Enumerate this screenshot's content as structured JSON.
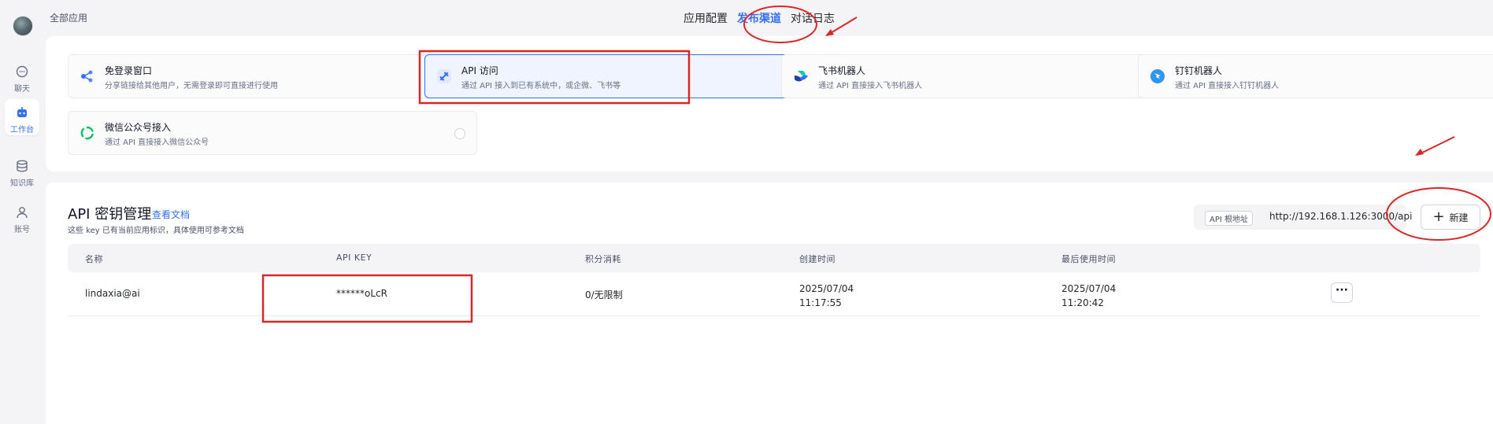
{
  "breadcrumb": "全部应用",
  "sidebar": {
    "items": [
      {
        "label": "聊天"
      },
      {
        "label": "工作台"
      },
      {
        "label": "知识库"
      },
      {
        "label": "账号"
      }
    ]
  },
  "tabs": [
    {
      "label": "应用配置"
    },
    {
      "label": "发布渠道"
    },
    {
      "label": "对话日志"
    }
  ],
  "channels": [
    {
      "title": "免登录窗口",
      "desc": "分享链接给其他用户，无需登录即可直接进行使用"
    },
    {
      "title": "API 访问",
      "desc": "通过 API 接入到已有系统中，或企微、飞书等"
    },
    {
      "title": "飞书机器人",
      "desc": "通过 API 直接接入飞书机器人"
    },
    {
      "title": "钉钉机器人",
      "desc": "通过 API 直接接入钉钉机器人"
    },
    {
      "title": "微信公众号接入",
      "desc": "通过 API 直接接入微信公众号"
    }
  ],
  "api": {
    "title": "API 密钥管理",
    "doc_link": "查看文档",
    "subtitle": "这些 key 已有当前应用标识，具体使用可参考文档",
    "base_tag": "API 根地址",
    "base_url": "http://192.168.1.126:3000/api",
    "new_label": "新建"
  },
  "table": {
    "headers": [
      "名称",
      "API KEY",
      "积分消耗",
      "创建时间",
      "最后使用时间"
    ],
    "rows": [
      {
        "name": "lindaxia@ai",
        "key": "******oLcR",
        "usage": "0/无限制",
        "created_date": "2025/07/04",
        "created_time": "11:17:55",
        "last_date": "2025/07/04",
        "last_time": "11:20:42"
      }
    ]
  },
  "colors": {
    "accent": "#3370ff",
    "annotation": "#e02424"
  }
}
